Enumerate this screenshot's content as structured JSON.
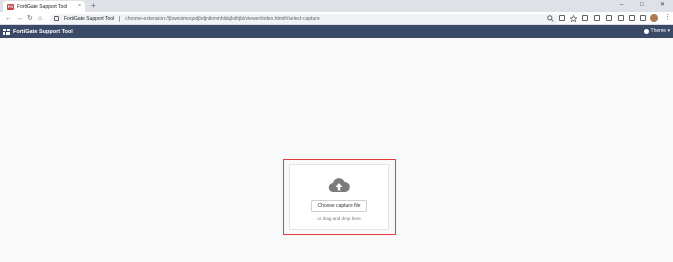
{
  "browser": {
    "tab": {
      "favicon_label": "FG",
      "title": "FortiGate Support Tool",
      "close": "×"
    },
    "new_tab": "+",
    "window": {
      "minimize": "–",
      "maximize": "□",
      "close": "✕"
    },
    "nav": {
      "back": "←",
      "forward": "→",
      "reload": "↻",
      "home": "⌂"
    },
    "omnibox": {
      "site": "FortiGate Support Tool",
      "url": "chrome-extension://jbwesimoqodjbdjnikmmhldsjkdhjbi/viewer/index.html#/select-capture"
    },
    "menu": "⋮"
  },
  "app": {
    "title": "FortiGate Support Tool",
    "theme_label": "Theme ▾"
  },
  "upload": {
    "button_label": "Choose capture file",
    "hint": "or drag and drop here"
  },
  "colors": {
    "header_bg": "#3b4a66",
    "highlight_border": "#e23c3c",
    "page_bg": "#f9f9fa"
  },
  "icons": [
    "cloud-upload-icon",
    "search-icon",
    "star-icon",
    "extensions-icon"
  ]
}
